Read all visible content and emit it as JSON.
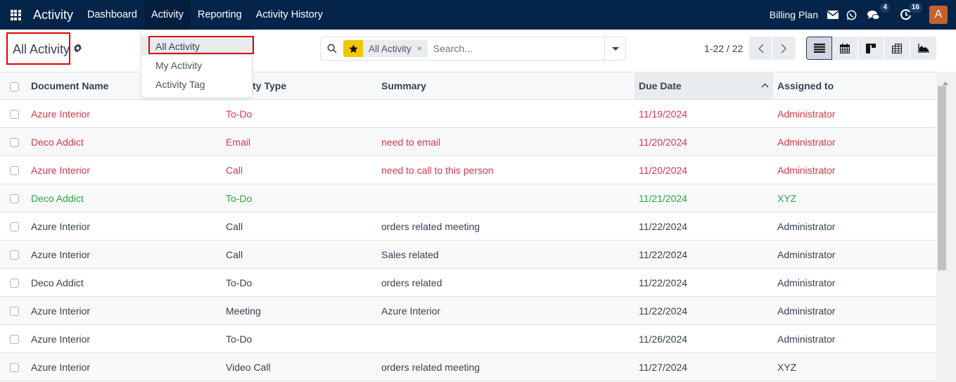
{
  "navbar": {
    "app_name": "Activity",
    "menu": [
      "Dashboard",
      "Activity",
      "Reporting",
      "Activity History"
    ],
    "active_menu": "Activity",
    "company": "Billing Plan",
    "messages_count": "4",
    "activities_count": "16",
    "avatar_letter": "A"
  },
  "control": {
    "title": "All Activity",
    "dropdown_items": [
      "All Activity",
      "My Activity",
      "Activity Tag"
    ],
    "search": {
      "facet_label": "All Activity",
      "facet_remove": "×",
      "placeholder": "Search..."
    },
    "pager": "1-22 / 22",
    "views": [
      "list",
      "calendar",
      "kanban",
      "pivot",
      "graph"
    ],
    "active_view": "list"
  },
  "table": {
    "columns": [
      "Document Name",
      "Activity Type",
      "Summary",
      "Due Date",
      "Assigned to"
    ],
    "sorted_column": "Due Date",
    "sort_direction": "ascending",
    "rows": [
      {
        "doc": "Azure Interior",
        "type": "To-Do",
        "summary": "",
        "due": "11/19/2024",
        "assigned": "Administrator",
        "status": "overdue"
      },
      {
        "doc": "Deco Addict",
        "type": "Email",
        "summary": "need to email",
        "due": "11/20/2024",
        "assigned": "Administrator",
        "status": "overdue"
      },
      {
        "doc": "Azure Interior",
        "type": "Call",
        "summary": "need to call to this person",
        "due": "11/20/2024",
        "assigned": "Administrator",
        "status": "overdue"
      },
      {
        "doc": "Deco Addict",
        "type": "To-Do",
        "summary": "",
        "due": "11/21/2024",
        "assigned": "XYZ",
        "status": "today"
      },
      {
        "doc": "Azure Interior",
        "type": "Call",
        "summary": "orders related meeting",
        "due": "11/22/2024",
        "assigned": "Administrator",
        "status": "planned"
      },
      {
        "doc": "Azure Interior",
        "type": "Call",
        "summary": "Sales related",
        "due": "11/22/2024",
        "assigned": "Administrator",
        "status": "planned"
      },
      {
        "doc": "Deco Addict",
        "type": "To-Do",
        "summary": "orders related",
        "due": "11/22/2024",
        "assigned": "Administrator",
        "status": "planned"
      },
      {
        "doc": "Azure Interior",
        "type": "Meeting",
        "summary": "Azure Interior",
        "due": "11/22/2024",
        "assigned": "Administrator",
        "status": "planned"
      },
      {
        "doc": "Azure Interior",
        "type": "To-Do",
        "summary": "",
        "due": "11/26/2024",
        "assigned": "Administrator",
        "status": "planned"
      },
      {
        "doc": "Azure Interior",
        "type": "Video Call",
        "summary": "orders related meeting",
        "due": "11/27/2024",
        "assigned": "XYZ",
        "status": "planned"
      }
    ]
  },
  "colors": {
    "navbar_bg": "#05244a",
    "overdue": "#d9374a",
    "today": "#28a745",
    "favorite_star": "#f2c500",
    "avatar_bg": "#c4622d",
    "highlight_box": "#e00000"
  }
}
